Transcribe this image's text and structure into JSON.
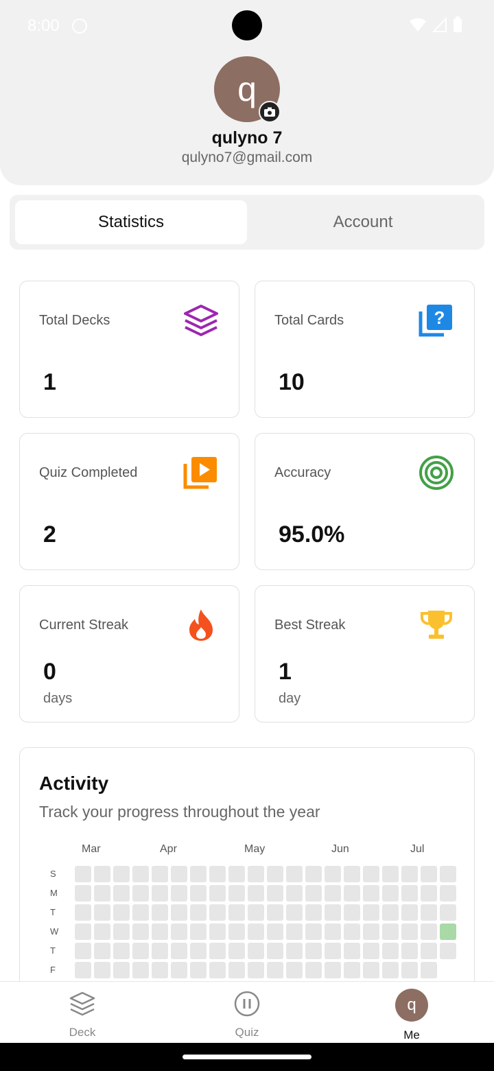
{
  "status_bar": {
    "time": "8:00"
  },
  "profile": {
    "avatar_letter": "q",
    "name": "qulyno 7",
    "email": "qulyno7@gmail.com"
  },
  "tabs": [
    {
      "label": "Statistics",
      "selected": true
    },
    {
      "label": "Account",
      "selected": false
    }
  ],
  "stats": {
    "total_decks": {
      "label": "Total Decks",
      "value": "1",
      "icon": "layers-icon",
      "color": "#9c27b0"
    },
    "total_cards": {
      "label": "Total Cards",
      "value": "10",
      "icon": "question-cards-icon",
      "color": "#1e88e5"
    },
    "quiz_completed": {
      "label": "Quiz Completed",
      "value": "2",
      "icon": "play-library-icon",
      "color": "#fb8c00"
    },
    "accuracy": {
      "label": "Accuracy",
      "value": "95.0%",
      "icon": "target-icon",
      "color": "#43a047"
    },
    "current_streak": {
      "label": "Current Streak",
      "value": "0",
      "unit": "days",
      "icon": "flame-icon",
      "color": "#f4511e"
    },
    "best_streak": {
      "label": "Best Streak",
      "value": "1",
      "unit": "day",
      "icon": "trophy-icon",
      "color": "#fbc02d"
    }
  },
  "activity": {
    "title": "Activity",
    "subtitle": "Track your progress throughout the year",
    "months": [
      "Mar",
      "Apr",
      "May",
      "Jun",
      "Jul"
    ],
    "day_labels": [
      "S",
      "M",
      "T",
      "W",
      "T",
      "F"
    ],
    "active_cell_color": "#a8d9a6",
    "empty_cell_color": "#e6e6e6",
    "active_days": [
      {
        "week": 19,
        "day": 3
      }
    ]
  },
  "bottom_nav": [
    {
      "label": "Deck",
      "icon": "layers-icon",
      "active": false
    },
    {
      "label": "Quiz",
      "icon": "pause-circle-icon",
      "active": false
    },
    {
      "label": "Me",
      "icon": "avatar",
      "avatar_letter": "q",
      "active": true
    }
  ]
}
